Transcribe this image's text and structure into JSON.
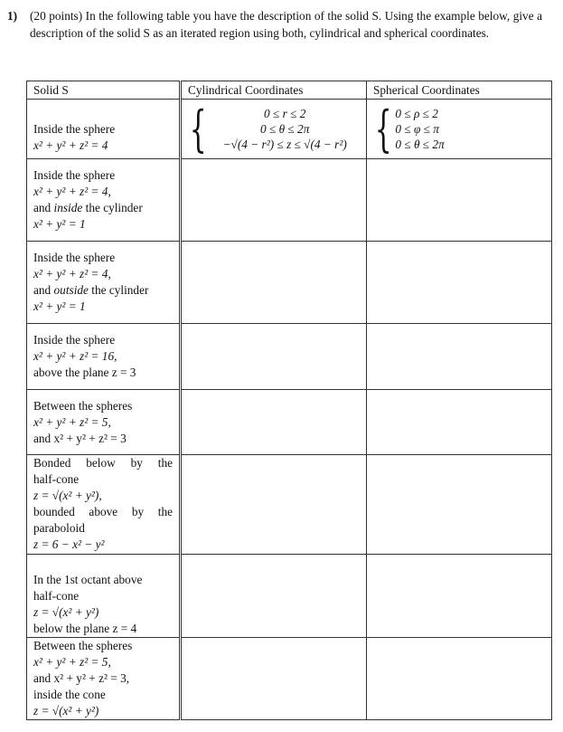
{
  "problem": {
    "number": "1)",
    "text": "(20 points) In the following table you have the description of the solid S. Using the example below, give a description of the solid S as an iterated region using both, cylindrical and spherical coordinates."
  },
  "table": {
    "headers": [
      "Solid S",
      "Cylindrical Coordinates",
      "Spherical Coordinates"
    ],
    "example": {
      "solid": [
        "Inside the sphere",
        "x² + y² + z² = 4"
      ],
      "cylindrical": [
        "0 ≤ r ≤ 2",
        "0 ≤ θ ≤ 2π",
        "−√(4 − r²) ≤ z ≤ √(4 − r²)"
      ],
      "spherical": [
        "0 ≤ ρ ≤ 2",
        "0 ≤ φ ≤ π",
        "0 ≤ θ ≤ 2π"
      ]
    },
    "rows": [
      {
        "solid": [
          "Inside the sphere",
          "x² + y² + z² = 4,",
          "and inside the cylinder",
          "x² + y² = 1"
        ],
        "cylindrical": "",
        "spherical": ""
      },
      {
        "solid": [
          "Inside the sphere",
          "x² + y² + z² = 4,",
          "and outside the cylinder",
          "x² + y² = 1"
        ],
        "cylindrical": "",
        "spherical": ""
      },
      {
        "solid": [
          "Inside the sphere",
          "x² + y² + z² = 16,",
          "above the plane z = 3"
        ],
        "cylindrical": "",
        "spherical": ""
      },
      {
        "solid": [
          "Between the spheres",
          "x² + y² + z² = 5,",
          "and x² + y² + z² = 3"
        ],
        "cylindrical": "",
        "spherical": ""
      },
      {
        "solid": [
          "Bonded below by the",
          "half-cone",
          "z = √(x² + y²),",
          "bounded above by the",
          "paraboloid",
          "z = 6 − x² − y²"
        ],
        "cylindrical": "",
        "spherical": ""
      },
      {
        "solid": [
          "In the 1st octant above",
          "half-cone",
          "z = √(x² + y²)",
          "below the plane z = 4"
        ],
        "cylindrical": "",
        "spherical": ""
      },
      {
        "solid": [
          "Between the spheres",
          "x² + y² + z² = 5,",
          "and x² + y² + z² = 3,",
          "inside the cone",
          "z = √(x² + y²)"
        ],
        "cylindrical": "",
        "spherical": ""
      }
    ]
  }
}
